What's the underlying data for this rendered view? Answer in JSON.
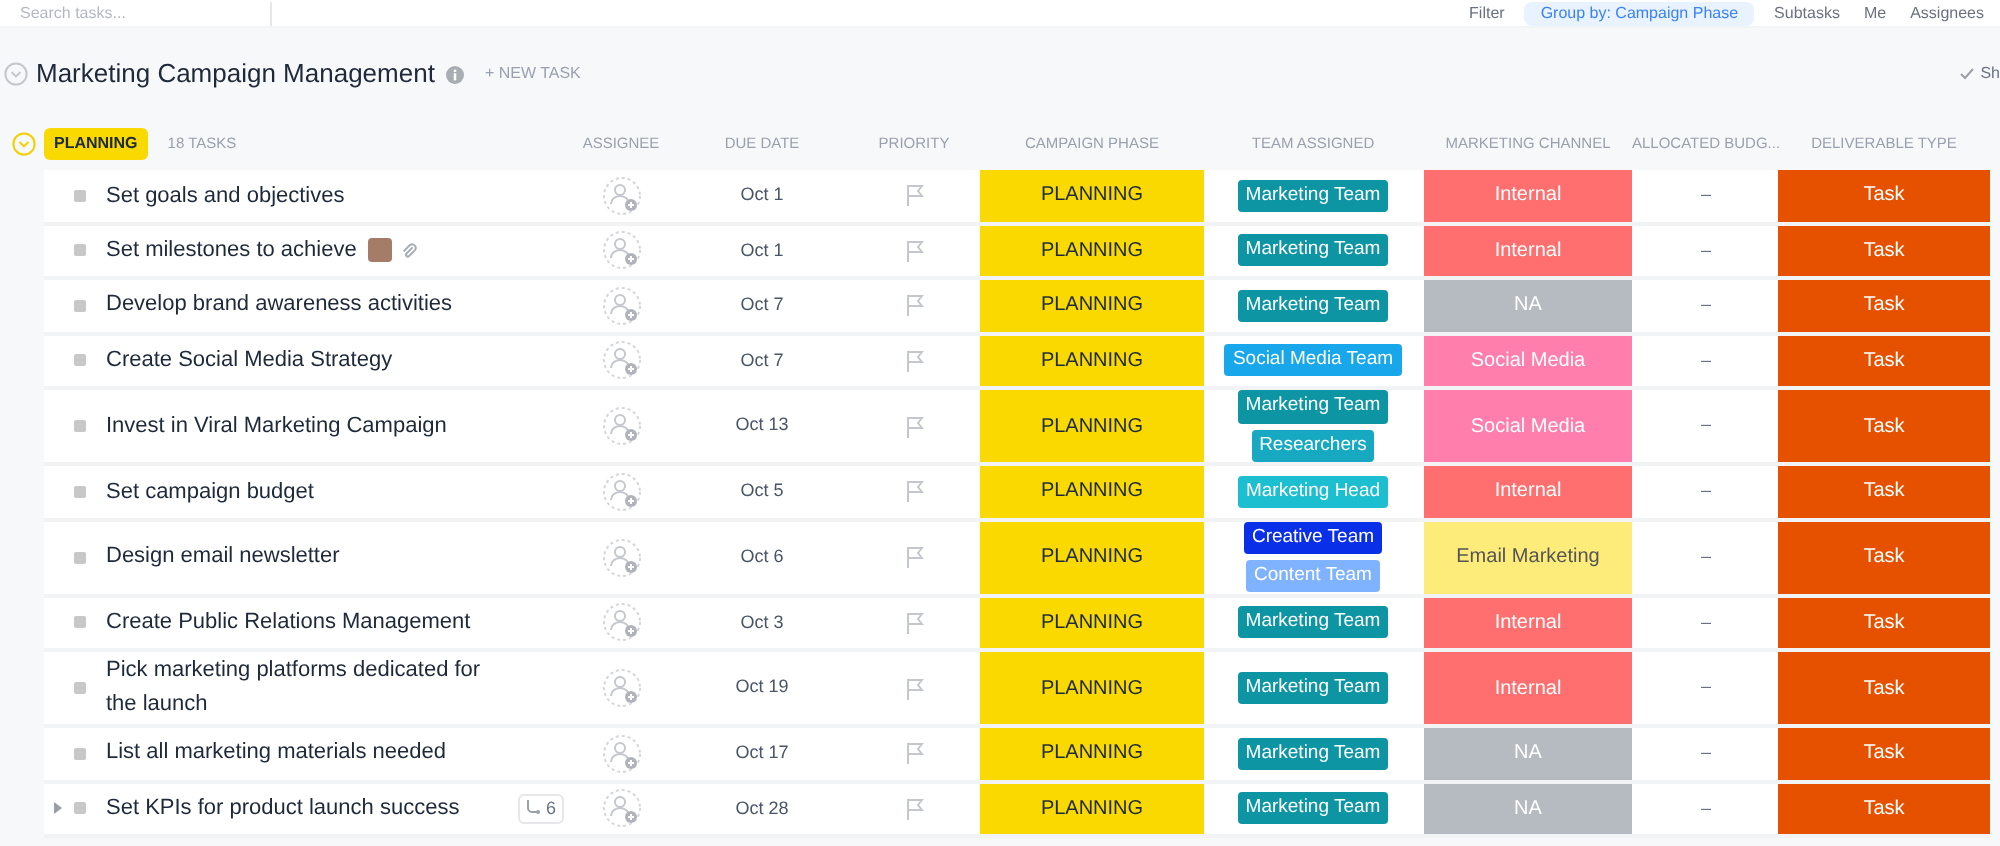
{
  "toolbar": {
    "search": {
      "placeholder": "Search tasks..."
    },
    "items": [
      {
        "label": "Filter",
        "selected": false
      },
      {
        "label": "Group by: Campaign Phase",
        "selected": true
      },
      {
        "label": "Subtasks",
        "selected": false
      },
      {
        "label": "Me",
        "selected": false
      },
      {
        "label": "Assignees",
        "selected": false
      }
    ]
  },
  "list": {
    "title": "Marketing Campaign Management",
    "new_task": "+ NEW TASK",
    "show": "Sh"
  },
  "group": {
    "status": "PLANNING",
    "count": "18 TASKS",
    "expanded": true
  },
  "columns": [
    "ASSIGNEE",
    "DUE DATE",
    "PRIORITY",
    "CAMPAIGN PHASE",
    "TEAM ASSIGNED",
    "MARKETING CHANNEL",
    "ALLOCATED BUDG...",
    "DELIVERABLE TYPE"
  ],
  "rows": [
    {
      "name": "Set goals and objectives",
      "due": "Oct 1",
      "phase": {
        "label": "PLANNING",
        "color": "#f9d900"
      },
      "teams": [
        {
          "label": "Marketing Team",
          "color": "#0e95a3"
        }
      ],
      "channel": {
        "label": "Internal",
        "color": "#ff6f6f"
      },
      "budget": "–",
      "type": {
        "label": "Task",
        "color": "#e65100"
      }
    },
    {
      "name": "Set milestones to achieve",
      "thumbnail": true,
      "attachment": true,
      "due": "Oct 1",
      "phase": {
        "label": "PLANNING",
        "color": "#f9d900"
      },
      "teams": [
        {
          "label": "Marketing Team",
          "color": "#0e95a3"
        }
      ],
      "channel": {
        "label": "Internal",
        "color": "#ff6f6f"
      },
      "budget": "–",
      "type": {
        "label": "Task",
        "color": "#e65100"
      }
    },
    {
      "name": "Develop brand awareness activities",
      "due": "Oct 7",
      "phase": {
        "label": "PLANNING",
        "color": "#f9d900"
      },
      "teams": [
        {
          "label": "Marketing Team",
          "color": "#0e95a3"
        }
      ],
      "channel": {
        "label": "NA",
        "color": "#b5bbc0"
      },
      "budget": "–",
      "type": {
        "label": "Task",
        "color": "#e65100"
      }
    },
    {
      "name": "Create Social Media Strategy",
      "due": "Oct 7",
      "phase": {
        "label": "PLANNING",
        "color": "#f9d900"
      },
      "teams": [
        {
          "label": "Social Media Team",
          "color": "#19a7ec"
        }
      ],
      "channel": {
        "label": "Social Media",
        "color": "#ff7eab"
      },
      "budget": "–",
      "type": {
        "label": "Task",
        "color": "#e65100"
      }
    },
    {
      "name": "Invest in Viral Marketing Campaign",
      "due": "Oct 13",
      "phase": {
        "label": "PLANNING",
        "color": "#f9d900"
      },
      "teams": [
        {
          "label": "Marketing Team",
          "color": "#0e95a3"
        },
        {
          "label": "Researchers",
          "color": "#17a9c2"
        }
      ],
      "channel": {
        "label": "Social Media",
        "color": "#ff7eab"
      },
      "budget": "–",
      "type": {
        "label": "Task",
        "color": "#e65100"
      }
    },
    {
      "name": "Set campaign budget",
      "due": "Oct 5",
      "phase": {
        "label": "PLANNING",
        "color": "#f9d900"
      },
      "teams": [
        {
          "label": "Marketing Head",
          "color": "#1bbfd0"
        }
      ],
      "channel": {
        "label": "Internal",
        "color": "#ff6f6f"
      },
      "budget": "–",
      "type": {
        "label": "Task",
        "color": "#e65100"
      }
    },
    {
      "name": "Design email newsletter",
      "due": "Oct 6",
      "phase": {
        "label": "PLANNING",
        "color": "#f9d900"
      },
      "teams": [
        {
          "label": "Creative Team",
          "color": "#0a2fe8"
        },
        {
          "label": "Content Team",
          "color": "#7fb2ff"
        }
      ],
      "channel": {
        "label": "Email Marketing",
        "color": "#fdec7a"
      },
      "budget": "–",
      "type": {
        "label": "Task",
        "color": "#e65100"
      }
    },
    {
      "name": "Create Public Relations Management",
      "due": "Oct 3",
      "phase": {
        "label": "PLANNING",
        "color": "#f9d900"
      },
      "teams": [
        {
          "label": "Marketing Team",
          "color": "#0e95a3"
        }
      ],
      "channel": {
        "label": "Internal",
        "color": "#ff6f6f"
      },
      "budget": "–",
      "type": {
        "label": "Task",
        "color": "#e65100"
      }
    },
    {
      "name": "Pick marketing platforms dedicated for the launch",
      "due": "Oct 19",
      "phase": {
        "label": "PLANNING",
        "color": "#f9d900"
      },
      "teams": [
        {
          "label": "Marketing Team",
          "color": "#0e95a3"
        }
      ],
      "channel": {
        "label": "Internal",
        "color": "#ff6f6f"
      },
      "budget": "–",
      "type": {
        "label": "Task",
        "color": "#e65100"
      }
    },
    {
      "name": "List all marketing materials needed",
      "due": "Oct 17",
      "phase": {
        "label": "PLANNING",
        "color": "#f9d900"
      },
      "teams": [
        {
          "label": "Marketing Team",
          "color": "#0e95a3"
        }
      ],
      "channel": {
        "label": "NA",
        "color": "#b5bbc0"
      },
      "budget": "–",
      "type": {
        "label": "Task",
        "color": "#e65100"
      }
    },
    {
      "name": "Set KPIs for product launch success",
      "expandable": true,
      "subtasks": "6",
      "due": "Oct 28",
      "phase": {
        "label": "PLANNING",
        "color": "#f9d900"
      },
      "teams": [
        {
          "label": "Marketing Team",
          "color": "#0e95a3"
        }
      ],
      "channel": {
        "label": "NA",
        "color": "#b5bbc0"
      },
      "budget": "–",
      "type": {
        "label": "Task",
        "color": "#e65100"
      }
    }
  ]
}
